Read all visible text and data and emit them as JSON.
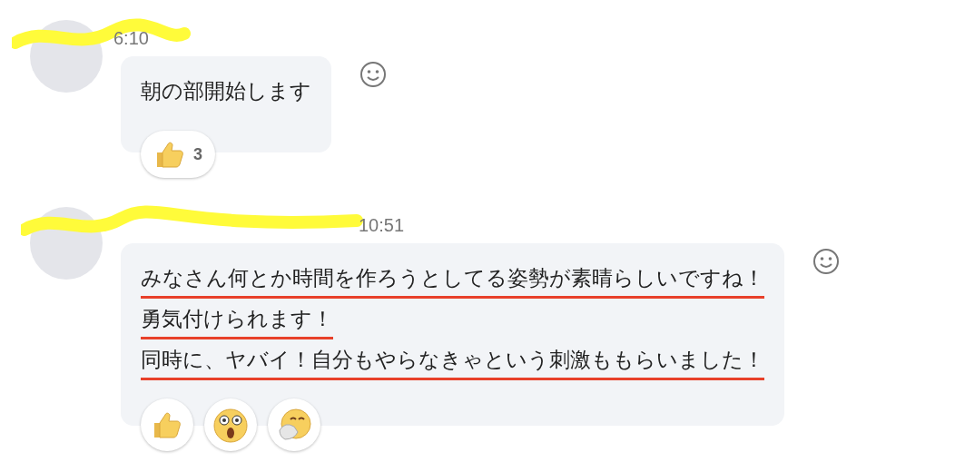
{
  "messages": [
    {
      "sender": {
        "redacted": true
      },
      "time": "6:10",
      "lines": [
        {
          "text": "朝の部開始します",
          "underlined": false
        }
      ],
      "reactions": [
        {
          "kind": "thumbs-up",
          "count": "3"
        }
      ]
    },
    {
      "sender": {
        "redacted": true
      },
      "time": "10:51",
      "lines": [
        {
          "text": "みなさん何とか時間を作ろうとしてる姿勢が素晴らしいですね！",
          "underlined": true
        },
        {
          "text": "勇気付けられます！",
          "underlined": true
        },
        {
          "text": "同時に、ヤバイ！自分もやらなきゃという刺激ももらいました！",
          "underlined": true
        }
      ],
      "reactions": [
        {
          "kind": "thumbs-up"
        },
        {
          "kind": "astonished"
        },
        {
          "kind": "hand-over-mouth"
        }
      ]
    }
  ]
}
